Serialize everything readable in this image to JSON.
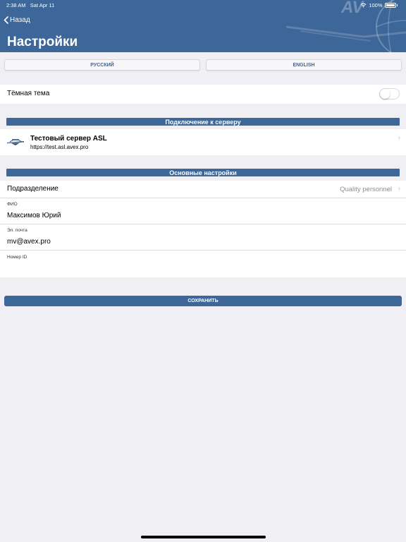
{
  "status": {
    "time": "2:38 AM",
    "date": "Sat Apr 11",
    "battery": "100%"
  },
  "header": {
    "back_label": "Назад",
    "title": "Настройки",
    "deco_text": "AV"
  },
  "languages": {
    "russian": "РУССКИЙ",
    "english": "ENGLISH"
  },
  "dark_theme": {
    "label": "Тёмная тема",
    "enabled": false
  },
  "server_section": {
    "title": "Подключение к серверу",
    "server_name": "Тестовый сервер ASL",
    "server_url": "https://test.asl.avex.pro"
  },
  "main_section": {
    "title": "Основные настройки",
    "division_label": "Подразделение",
    "division_value": "Quality personnel",
    "name_label": "ФИО",
    "name_value": "Максимов Юрий",
    "email_label": "Эл. почта",
    "email_value": "mv@avex.pro",
    "id_label": "Номер ID",
    "id_value": ""
  },
  "save_label": "СОХРАНИТЬ",
  "colors": {
    "brand": "#3d6699",
    "background": "#efeff4"
  }
}
